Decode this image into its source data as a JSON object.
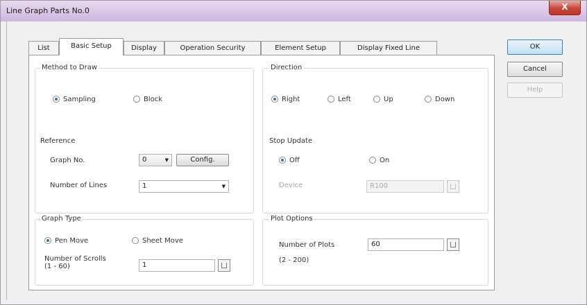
{
  "window": {
    "title": "Line Graph Parts No.0",
    "close_label": "X"
  },
  "tabs": [
    {
      "label": "List"
    },
    {
      "label": "Basic Setup",
      "active": true
    },
    {
      "label": "Display"
    },
    {
      "label": "Operation Security"
    },
    {
      "label": "Element Setup"
    },
    {
      "label": "Display Fixed Line"
    }
  ],
  "buttons": {
    "ok": "OK",
    "cancel": "Cancel",
    "help": "Help"
  },
  "method": {
    "title": "Method to Draw",
    "options": [
      "Sampling",
      "Block"
    ],
    "selected": "Sampling"
  },
  "direction": {
    "title": "Direction",
    "options": [
      "Right",
      "Left",
      "Up",
      "Down"
    ],
    "selected": "Right"
  },
  "reference": {
    "title": "Reference",
    "graph_no_label": "Graph No.",
    "graph_no_value": "0",
    "config_label": "Config.",
    "lines_label": "Number of Lines",
    "lines_value": "1"
  },
  "stop_update": {
    "title": "Stop Update",
    "options": [
      "Off",
      "On"
    ],
    "selected": "Off",
    "device_label": "Device",
    "device_value": "R100"
  },
  "graph_type": {
    "title": "Graph Type",
    "options": [
      "Pen Move",
      "Sheet Move"
    ],
    "selected": "Pen Move",
    "scrolls_label": "Number of Scrolls",
    "scrolls_range": "(1 - 60)",
    "scrolls_value": "1"
  },
  "plot_options": {
    "title": "Plot Options",
    "plots_label": "Number of Plots",
    "plots_value": "60",
    "plots_range": "(2 - 200)"
  },
  "icons": {
    "close": "close-icon",
    "keypad": "keypad-icon",
    "dropdown": "chevron-down-icon",
    "radio": "radio-icon"
  }
}
